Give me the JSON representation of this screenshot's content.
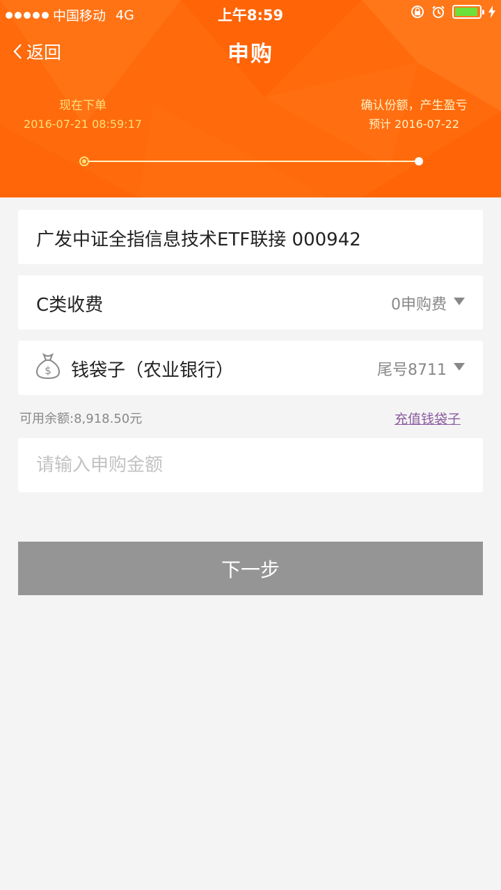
{
  "status_bar": {
    "carrier": "中国移动",
    "network": "4G",
    "time": "上午8:59"
  },
  "nav": {
    "back_label": "返回",
    "title": "申购"
  },
  "steps": {
    "start_label": "现在下单",
    "start_time": "2016-07-21 08:59:17",
    "end_label": "确认份额，产生盈亏",
    "end_time": "预计 2016-07-22"
  },
  "fund": {
    "name": "广发中证全指信息技术ETF联接 000942"
  },
  "fee": {
    "label": "C类收费",
    "value": "0申购费"
  },
  "wallet": {
    "label": "钱袋子（农业银行）",
    "value": "尾号8711",
    "icon": "money-bag-icon"
  },
  "balance": {
    "text": "可用余额:8,918.50元",
    "recharge_label": "充值钱袋子"
  },
  "amount": {
    "value": "",
    "placeholder": "请输入申购金额"
  },
  "next_button": {
    "label": "下一步"
  },
  "colors": {
    "header": "#ff6a0c",
    "accent_text": "#ffe07a",
    "button": "#959595",
    "background": "#f4f4f4",
    "link": "#8a5a9e"
  }
}
